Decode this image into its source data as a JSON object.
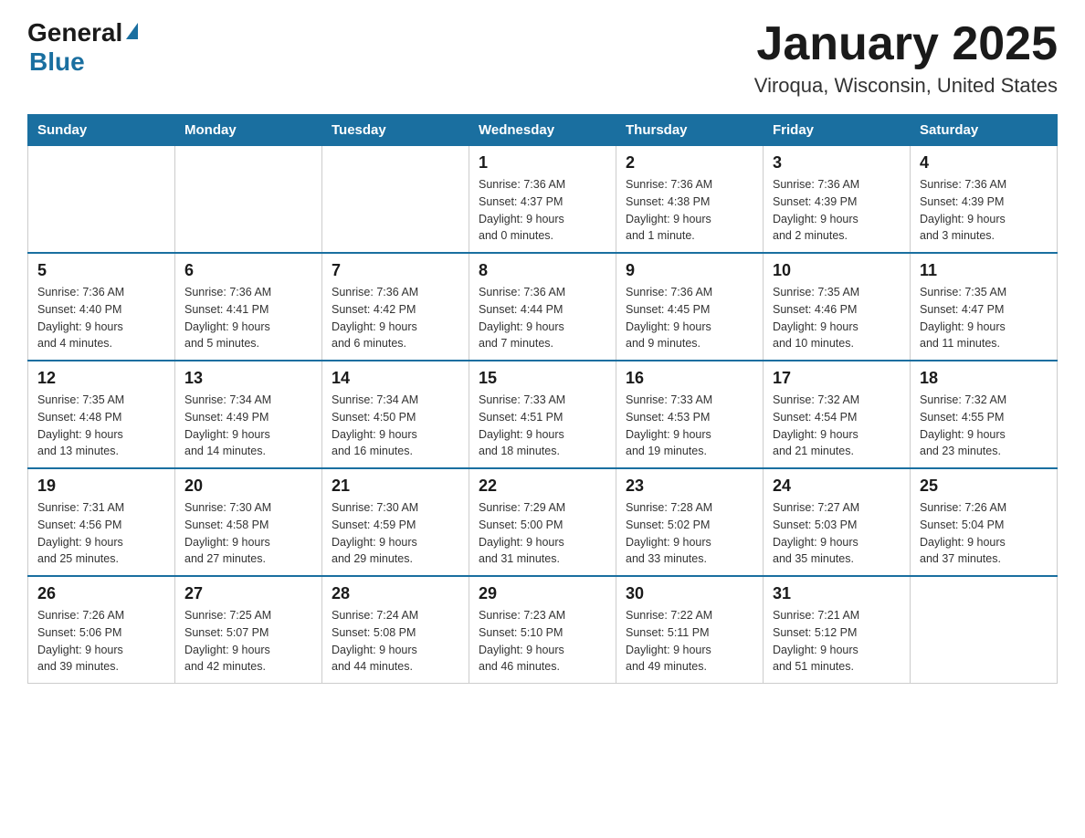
{
  "header": {
    "logo_general": "General",
    "logo_blue": "Blue",
    "title": "January 2025",
    "subtitle": "Viroqua, Wisconsin, United States"
  },
  "days_of_week": [
    "Sunday",
    "Monday",
    "Tuesday",
    "Wednesday",
    "Thursday",
    "Friday",
    "Saturday"
  ],
  "weeks": [
    [
      {
        "day": "",
        "info": ""
      },
      {
        "day": "",
        "info": ""
      },
      {
        "day": "",
        "info": ""
      },
      {
        "day": "1",
        "info": "Sunrise: 7:36 AM\nSunset: 4:37 PM\nDaylight: 9 hours\nand 0 minutes."
      },
      {
        "day": "2",
        "info": "Sunrise: 7:36 AM\nSunset: 4:38 PM\nDaylight: 9 hours\nand 1 minute."
      },
      {
        "day": "3",
        "info": "Sunrise: 7:36 AM\nSunset: 4:39 PM\nDaylight: 9 hours\nand 2 minutes."
      },
      {
        "day": "4",
        "info": "Sunrise: 7:36 AM\nSunset: 4:39 PM\nDaylight: 9 hours\nand 3 minutes."
      }
    ],
    [
      {
        "day": "5",
        "info": "Sunrise: 7:36 AM\nSunset: 4:40 PM\nDaylight: 9 hours\nand 4 minutes."
      },
      {
        "day": "6",
        "info": "Sunrise: 7:36 AM\nSunset: 4:41 PM\nDaylight: 9 hours\nand 5 minutes."
      },
      {
        "day": "7",
        "info": "Sunrise: 7:36 AM\nSunset: 4:42 PM\nDaylight: 9 hours\nand 6 minutes."
      },
      {
        "day": "8",
        "info": "Sunrise: 7:36 AM\nSunset: 4:44 PM\nDaylight: 9 hours\nand 7 minutes."
      },
      {
        "day": "9",
        "info": "Sunrise: 7:36 AM\nSunset: 4:45 PM\nDaylight: 9 hours\nand 9 minutes."
      },
      {
        "day": "10",
        "info": "Sunrise: 7:35 AM\nSunset: 4:46 PM\nDaylight: 9 hours\nand 10 minutes."
      },
      {
        "day": "11",
        "info": "Sunrise: 7:35 AM\nSunset: 4:47 PM\nDaylight: 9 hours\nand 11 minutes."
      }
    ],
    [
      {
        "day": "12",
        "info": "Sunrise: 7:35 AM\nSunset: 4:48 PM\nDaylight: 9 hours\nand 13 minutes."
      },
      {
        "day": "13",
        "info": "Sunrise: 7:34 AM\nSunset: 4:49 PM\nDaylight: 9 hours\nand 14 minutes."
      },
      {
        "day": "14",
        "info": "Sunrise: 7:34 AM\nSunset: 4:50 PM\nDaylight: 9 hours\nand 16 minutes."
      },
      {
        "day": "15",
        "info": "Sunrise: 7:33 AM\nSunset: 4:51 PM\nDaylight: 9 hours\nand 18 minutes."
      },
      {
        "day": "16",
        "info": "Sunrise: 7:33 AM\nSunset: 4:53 PM\nDaylight: 9 hours\nand 19 minutes."
      },
      {
        "day": "17",
        "info": "Sunrise: 7:32 AM\nSunset: 4:54 PM\nDaylight: 9 hours\nand 21 minutes."
      },
      {
        "day": "18",
        "info": "Sunrise: 7:32 AM\nSunset: 4:55 PM\nDaylight: 9 hours\nand 23 minutes."
      }
    ],
    [
      {
        "day": "19",
        "info": "Sunrise: 7:31 AM\nSunset: 4:56 PM\nDaylight: 9 hours\nand 25 minutes."
      },
      {
        "day": "20",
        "info": "Sunrise: 7:30 AM\nSunset: 4:58 PM\nDaylight: 9 hours\nand 27 minutes."
      },
      {
        "day": "21",
        "info": "Sunrise: 7:30 AM\nSunset: 4:59 PM\nDaylight: 9 hours\nand 29 minutes."
      },
      {
        "day": "22",
        "info": "Sunrise: 7:29 AM\nSunset: 5:00 PM\nDaylight: 9 hours\nand 31 minutes."
      },
      {
        "day": "23",
        "info": "Sunrise: 7:28 AM\nSunset: 5:02 PM\nDaylight: 9 hours\nand 33 minutes."
      },
      {
        "day": "24",
        "info": "Sunrise: 7:27 AM\nSunset: 5:03 PM\nDaylight: 9 hours\nand 35 minutes."
      },
      {
        "day": "25",
        "info": "Sunrise: 7:26 AM\nSunset: 5:04 PM\nDaylight: 9 hours\nand 37 minutes."
      }
    ],
    [
      {
        "day": "26",
        "info": "Sunrise: 7:26 AM\nSunset: 5:06 PM\nDaylight: 9 hours\nand 39 minutes."
      },
      {
        "day": "27",
        "info": "Sunrise: 7:25 AM\nSunset: 5:07 PM\nDaylight: 9 hours\nand 42 minutes."
      },
      {
        "day": "28",
        "info": "Sunrise: 7:24 AM\nSunset: 5:08 PM\nDaylight: 9 hours\nand 44 minutes."
      },
      {
        "day": "29",
        "info": "Sunrise: 7:23 AM\nSunset: 5:10 PM\nDaylight: 9 hours\nand 46 minutes."
      },
      {
        "day": "30",
        "info": "Sunrise: 7:22 AM\nSunset: 5:11 PM\nDaylight: 9 hours\nand 49 minutes."
      },
      {
        "day": "31",
        "info": "Sunrise: 7:21 AM\nSunset: 5:12 PM\nDaylight: 9 hours\nand 51 minutes."
      },
      {
        "day": "",
        "info": ""
      }
    ]
  ]
}
